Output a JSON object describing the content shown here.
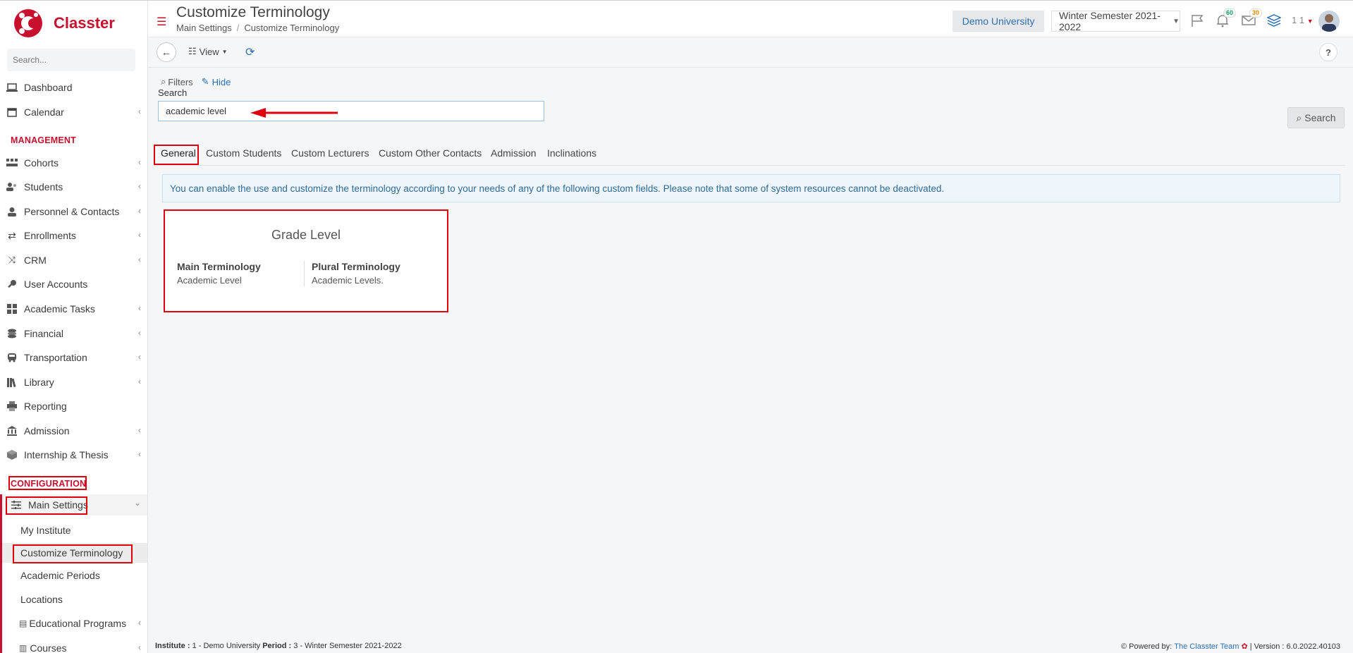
{
  "app": {
    "brand": "Classter"
  },
  "sidebar": {
    "search_placeholder": "Search...",
    "items_top": [
      {
        "label": "Dashboard",
        "icon": "laptop-icon"
      },
      {
        "label": "Calendar",
        "icon": "calendar-icon"
      }
    ],
    "management_label": "MANAGEMENT",
    "management": [
      {
        "label": "Cohorts",
        "icon": "cohorts-icon"
      },
      {
        "label": "Students",
        "icon": "students-icon"
      },
      {
        "label": "Personnel & Contacts",
        "icon": "person-icon"
      },
      {
        "label": "Enrollments",
        "icon": "exchange-icon"
      },
      {
        "label": "CRM",
        "icon": "shuffle-icon"
      },
      {
        "label": "User Accounts",
        "icon": "key-icon"
      },
      {
        "label": "Academic Tasks",
        "icon": "grid-icon"
      },
      {
        "label": "Financial",
        "icon": "coins-icon"
      },
      {
        "label": "Transportation",
        "icon": "bus-icon"
      },
      {
        "label": "Library",
        "icon": "books-icon"
      },
      {
        "label": "Reporting",
        "icon": "printer-icon"
      },
      {
        "label": "Admission",
        "icon": "institution-icon"
      },
      {
        "label": "Internship & Thesis",
        "icon": "box-icon"
      }
    ],
    "configuration_label": "CONFIGURATION",
    "main_settings_label": "Main Settings",
    "sub_items": [
      "My Institute",
      "Customize Terminology",
      "Academic Periods",
      "Locations"
    ],
    "educational_programs": "Educational Programs",
    "courses": "Courses"
  },
  "header": {
    "title": "Customize Terminology",
    "breadcrumb": [
      "Main Settings",
      "Customize Terminology"
    ],
    "university": "Demo University",
    "semester": "Winter Semester 2021-2022",
    "notifications_count": "60",
    "messages_count": "30",
    "user_label": "1 1"
  },
  "toolbar": {
    "view_label": "View",
    "help_label": "?"
  },
  "filters": {
    "filters_label": "Filters",
    "hide_label": "Hide",
    "search_label": "Search",
    "search_value": "academic level",
    "search_button": "Search"
  },
  "tabs": [
    "General",
    "Custom Students",
    "Custom Lecturers",
    "Custom Other Contacts",
    "Admission",
    "Inclinations"
  ],
  "info_text": "You can enable the use and customize the terminology according to your needs of any of the following custom fields. Please note that some of system resources cannot be deactivated.",
  "card": {
    "title": "Grade Level",
    "main_label": "Main Terminology",
    "main_value": "Academic Level",
    "plural_label": "Plural Terminology",
    "plural_value": "Academic Levels."
  },
  "footer": {
    "institute_label": "Institute :",
    "institute_value": "1 - Demo University",
    "period_label": "Period :",
    "period_value": "3 - Winter Semester 2021-2022",
    "powered_by": "Powered by:",
    "team": "The Classter Team",
    "version": "| Version : 6.0.2022.40103"
  },
  "colors": {
    "brand": "#c8102e",
    "link": "#2d6fb0",
    "annotation": "#e0000b"
  }
}
